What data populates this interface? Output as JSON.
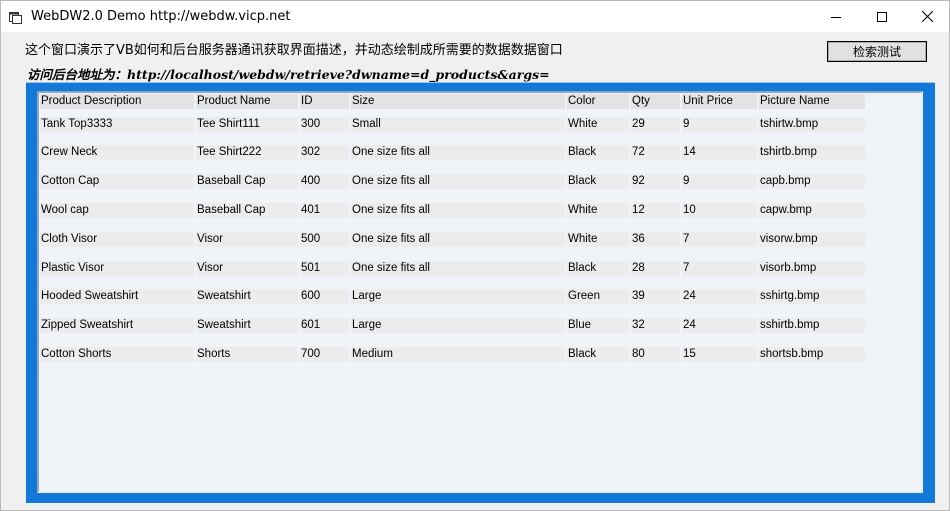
{
  "window": {
    "title": "WebDW2.0 Demo http://webdw.vicp.net"
  },
  "header": {
    "description": "这个窗口演示了VB如何和后台服务器通讯获取界面描述，并动态绘制成所需要的数据数据窗口",
    "url_line": "访问后台地址为：http://localhost/webdw/retrieve?dwname=d_products&args=",
    "search_button": "检索测试"
  },
  "table": {
    "columns": [
      "Product Description",
      "Product Name",
      "ID",
      "Size",
      "Color",
      "Qty",
      "Unit Price",
      "Picture Name"
    ],
    "rows": [
      [
        "Tank Top3333",
        "Tee Shirt111",
        "300",
        "Small",
        "White",
        "29",
        "9",
        "tshirtw.bmp"
      ],
      [
        "Crew Neck",
        "Tee Shirt222",
        "302",
        "One size fits all",
        "Black",
        "72",
        "14",
        "tshirtb.bmp"
      ],
      [
        "Cotton Cap",
        "Baseball Cap",
        "400",
        "One size fits all",
        "Black",
        "92",
        "9",
        "capb.bmp"
      ],
      [
        "Wool cap",
        "Baseball Cap",
        "401",
        "One size fits all",
        "White",
        "12",
        "10",
        "capw.bmp"
      ],
      [
        "Cloth Visor",
        "Visor",
        "500",
        "One size fits all",
        "White",
        "36",
        "7",
        "visorw.bmp"
      ],
      [
        "Plastic Visor",
        "Visor",
        "501",
        "One size fits all",
        "Black",
        "28",
        "7",
        "visorb.bmp"
      ],
      [
        "Hooded Sweatshirt",
        "Sweatshirt",
        "600",
        "Large",
        "Green",
        "39",
        "24",
        "sshirtg.bmp"
      ],
      [
        "Zipped Sweatshirt",
        "Sweatshirt",
        "601",
        "Large",
        "Blue",
        "32",
        "24",
        "sshirtb.bmp"
      ],
      [
        "Cotton Shorts",
        "Shorts",
        "700",
        "Medium",
        "Black",
        "80",
        "15",
        "shortsb.bmp"
      ]
    ]
  },
  "colors": {
    "frame_blue": "#1279d8",
    "grid_bg": "#f0f3f7",
    "cell_bg": "#ececec"
  },
  "icons": {
    "app": "app-window-icon",
    "minimize": "minimize-icon",
    "maximize": "maximize-icon",
    "close": "close-icon"
  }
}
